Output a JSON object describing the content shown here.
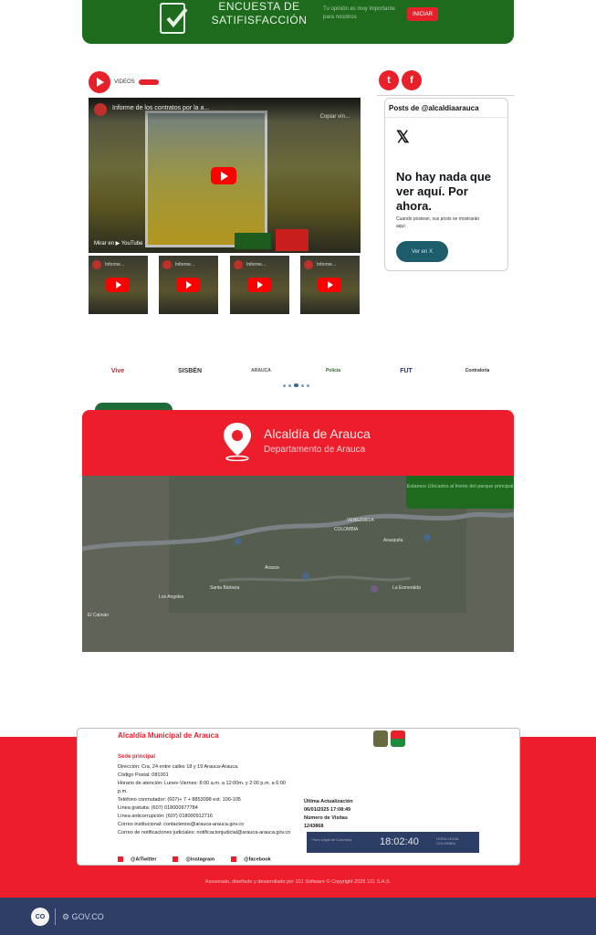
{
  "survey": {
    "title": "ENCUESTA DE SATIFISFACCIÓN",
    "subtitle": "Tu opinión es muy importante para nosotros",
    "button": "INICIAR",
    "bg_color": "#1e6b1e"
  },
  "videos": {
    "label": "VIDEOS",
    "main_title": "Informe de los contratos por la a...",
    "copy_link": "Copiar vín...",
    "watch_on": "Mirar en",
    "youtube": "YouTube",
    "thumb_titles": [
      "Informe...",
      "Informe...",
      "Informe...",
      "Informe..."
    ]
  },
  "social": {
    "twitter_icon": "twitter-icon",
    "facebook_icon": "facebook-icon"
  },
  "x_embed": {
    "posts_header": "Posts de @alcaldiaarauca",
    "logo": "𝕏",
    "heading": "No hay nada que ver aquí. Por ahora.",
    "description": "Cuando postean, sus posts se mostrarán aquí.",
    "button": "Ver en X"
  },
  "partners": [
    "Vive",
    "SISBÉN",
    "ARAUCA",
    "Policía",
    "FUT",
    "Contraloría"
  ],
  "location": {
    "title": "Alcaldía de Arauca",
    "subtitle": "Departamento de Arauca",
    "map_note": "Estamos Ubicados al frente del parque principal",
    "map_labels": [
      "Arauca",
      "VENEZUELA",
      "COLOMBIA",
      "Santa Bárbara",
      "Arauquita",
      "La Esmeralda",
      "Los Angeles",
      "El Caimán"
    ]
  },
  "footer": {
    "title": "Alcaldía Municipal de Arauca",
    "sede": "Sede principal",
    "lines": [
      "Dirección: Cra. 24 entre calles 18 y 19 Arauca-Arauca.",
      "Código Postal: 081001",
      "Horario de atención: Lunes-Viernes: 8:00 a.m. a 12:00m. y 2:00 p.m. a 6:00 p.m.",
      "Teléfono conmutador: (607)+ 7 + 8853098 ext. 100-105",
      "Línea gratuita: (607) 018000977784",
      "Línea anticorrupción: (607) 018000912716",
      "Correo institucional: contactenos@arauca-arauca.gov.co",
      "Correo de notificaciones judiciales: notificacionjudicial@arauca-arauca.gov.co"
    ],
    "update_label": "Última Actualización",
    "update_value": "06/01/2025 17:08:49",
    "visits_label": "Número de Visitas",
    "visits_value": "1243868",
    "clock_time": "18:02:40",
    "clock_left": "Hora Legal de Colombia",
    "clock_right": "HORA LEGAL COLOMBIA",
    "twitter": "@AlTwitter",
    "instagram": "@instagram",
    "facebook": "@facebook",
    "credit": "Asesorado, diseñado y desarrollado por  101 Software  © Copyright 2025 101 S.A.S."
  },
  "gov": {
    "co": "CO",
    "label": "GOV.CO"
  }
}
